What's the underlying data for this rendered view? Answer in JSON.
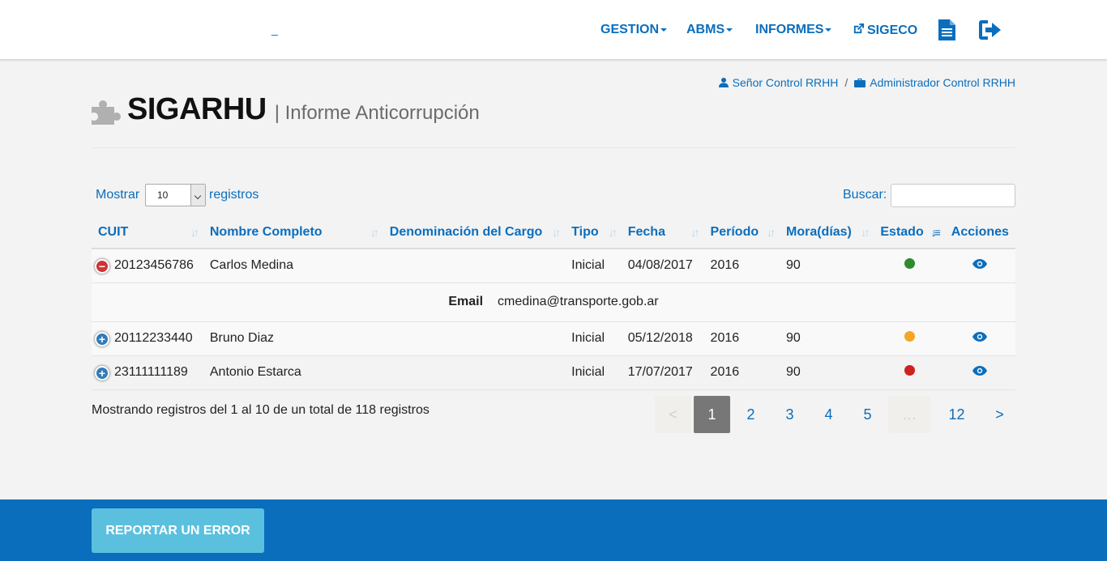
{
  "navbar": {
    "brand_dash": "_",
    "items": [
      {
        "label": "GESTION"
      },
      {
        "label": "ABMS"
      },
      {
        "label": "INFORMES"
      },
      {
        "label": "SIGECO"
      }
    ],
    "icons": [
      "external-link-icon",
      "document-icon",
      "logout-icon"
    ]
  },
  "breadcrumb": {
    "user": "Señor Control RRHH",
    "separator": "/",
    "role": "Administrador Control RRHH"
  },
  "page": {
    "title": "SIGARHU",
    "subtitle": "| Informe Anticorrupción"
  },
  "table_controls": {
    "show_label": "Mostrar",
    "show_value": "10",
    "records_label": "registros",
    "search_label": "Buscar:",
    "search_value": ""
  },
  "table": {
    "columns": [
      "CUIT",
      "Nombre Completo",
      "Denominación del Cargo",
      "Tipo",
      "Fecha",
      "Período",
      "Mora(días)",
      "Estado",
      "Acciones"
    ],
    "rows": [
      {
        "cuit": "20123456786",
        "nombre": "Carlos Medina",
        "cargo": "",
        "tipo": "Inicial",
        "fecha": "04/08/2017",
        "periodo": "2016",
        "mora": "90",
        "estado_color": "#2e8b2e",
        "expanded": true
      },
      {
        "cuit": "20112233440",
        "nombre": "Bruno Diaz",
        "cargo": "",
        "tipo": "Inicial",
        "fecha": "05/12/2018",
        "periodo": "2016",
        "mora": "90",
        "estado_color": "#f5a623",
        "expanded": false
      },
      {
        "cuit": "23111111189",
        "nombre": "Antonio Estarca",
        "cargo": "",
        "tipo": "Inicial",
        "fecha": "17/07/2017",
        "periodo": "2016",
        "mora": "90",
        "estado_color": "#cc2222",
        "expanded": false
      }
    ],
    "child_row": {
      "label": "Email",
      "value": "cmedina@transporte.gob.ar"
    }
  },
  "info": "Mostrando registros del 1 al 10 de un total de 118 registros",
  "pagination": {
    "prev": "<",
    "pages": [
      "1",
      "2",
      "3",
      "4",
      "5"
    ],
    "ellipsis": "…",
    "last": "12",
    "next": ">",
    "current": "1"
  },
  "footer": {
    "report_button": "REPORTAR UN ERROR"
  },
  "colors": {
    "brand": "#0a6ebd",
    "footer": "#0a6ebd",
    "report_button": "#5bc0de"
  }
}
